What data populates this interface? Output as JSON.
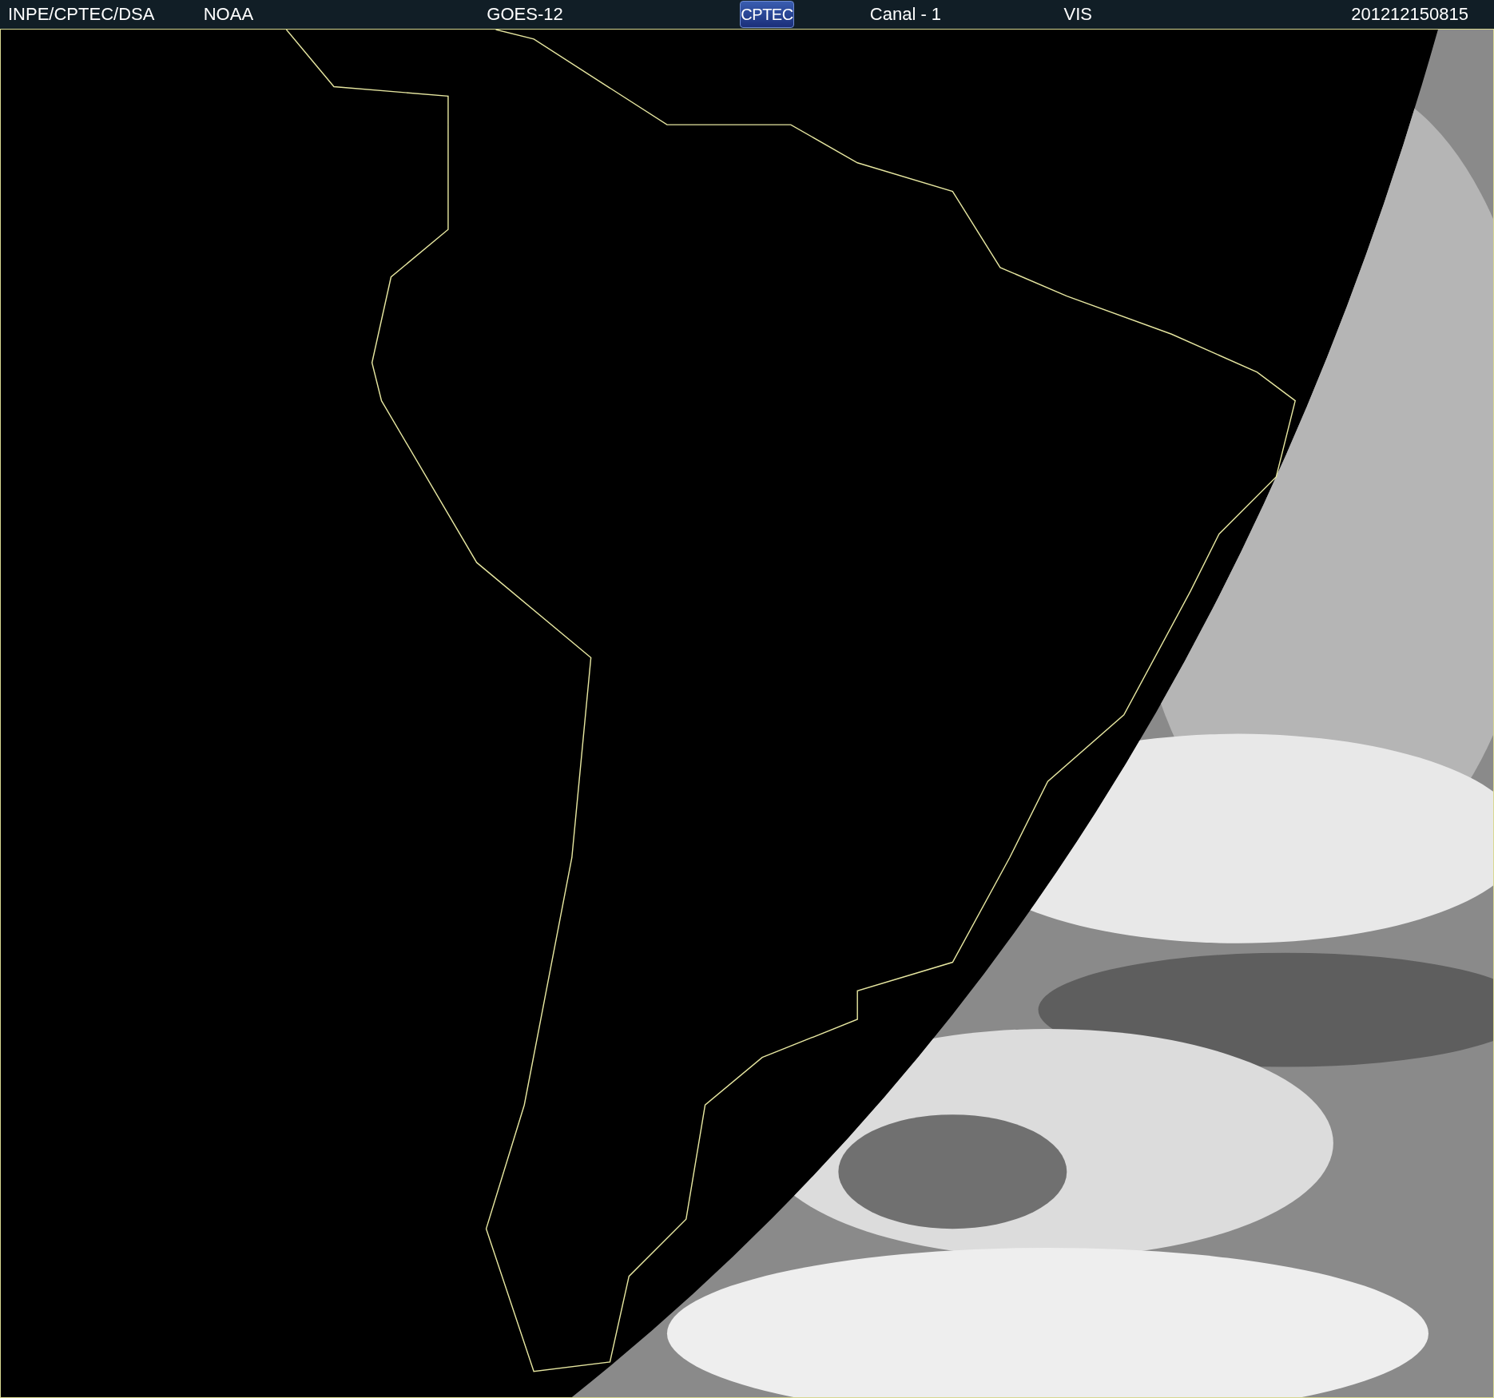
{
  "header": {
    "items": [
      {
        "kind": "text",
        "text": "INPE/CPTEC/DSA"
      },
      {
        "kind": "text",
        "text": "NOAA"
      },
      {
        "kind": "text",
        "text": "GOES-12"
      },
      {
        "kind": "logo",
        "text": "CPTEC"
      },
      {
        "kind": "text",
        "text": "Canal - 1"
      },
      {
        "kind": "text",
        "text": "VIS"
      },
      {
        "kind": "text",
        "text": "201212150815"
      }
    ]
  }
}
